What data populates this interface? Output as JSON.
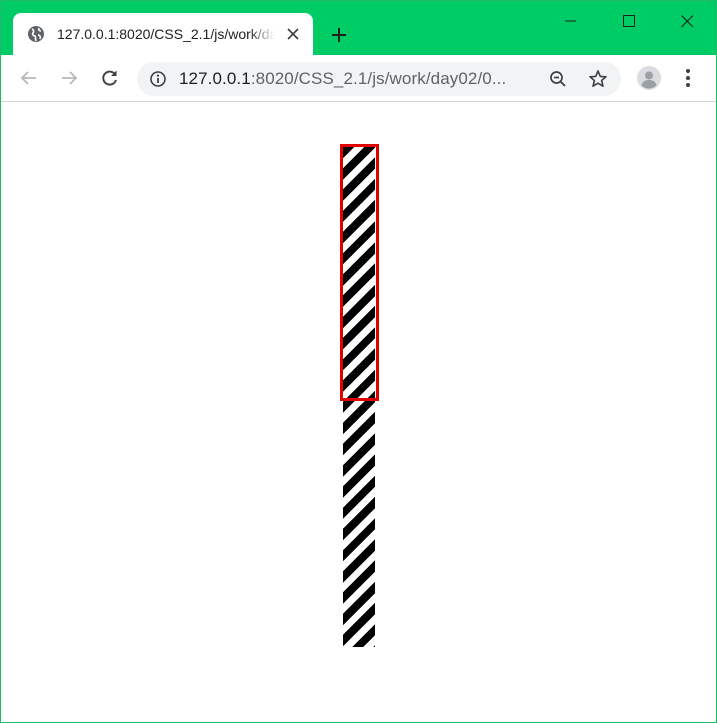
{
  "browser": {
    "tab": {
      "title": "127.0.0.1:8020/CSS_2.1/js/work/day02/0",
      "favicon": "globe-icon"
    },
    "address_bar": {
      "host": "127.0.0.1",
      "path": ":8020/CSS_2.1/js/work/day02/0..."
    },
    "toolbar_icons": [
      "back-icon",
      "forward-icon",
      "reload-icon",
      "info-icon",
      "zoom-icon",
      "star-icon",
      "profile-icon",
      "menu-icon"
    ],
    "window_controls": [
      "minimize-icon",
      "maximize-icon",
      "close-icon"
    ]
  },
  "colors": {
    "tabstrip": "#00cc66",
    "highlight_border": "#e00000",
    "stripe_dark": "#000000",
    "stripe_light": "#ffffff"
  }
}
